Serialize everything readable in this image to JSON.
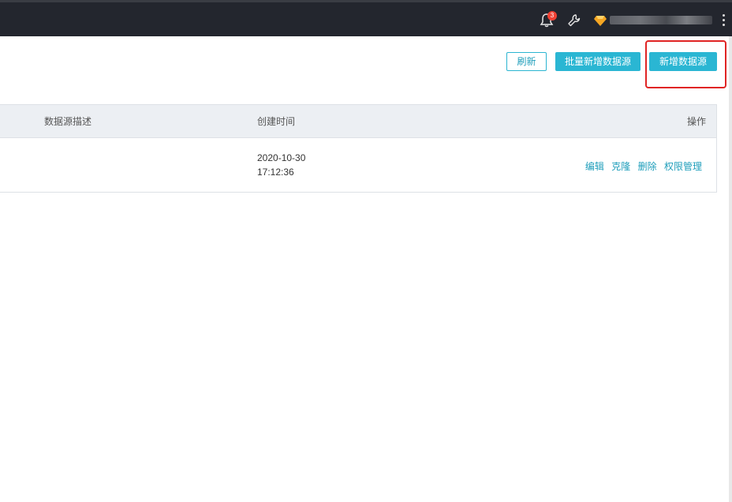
{
  "topbar": {
    "notification_count": "3",
    "icons": [
      "bell-icon",
      "wrench-icon",
      "diamond-icon",
      "more-vertical-icon"
    ]
  },
  "toolbar": {
    "refresh_label": "刷新",
    "batch_add_label": "批量新增数据源",
    "add_label": "新增数据源"
  },
  "table": {
    "columns": [
      "数据源描述",
      "创建时间",
      "操作"
    ],
    "rows": [
      {
        "description": "",
        "created_date": "2020-10-30",
        "created_time": "17:12:36",
        "actions": [
          "编辑",
          "克隆",
          "删除",
          "权限管理"
        ]
      }
    ]
  },
  "colors": {
    "accent": "#2ab6d3",
    "link": "#1f9ebb",
    "topbar": "#23262e",
    "highlight": "#e02424",
    "badge": "#f04134"
  }
}
